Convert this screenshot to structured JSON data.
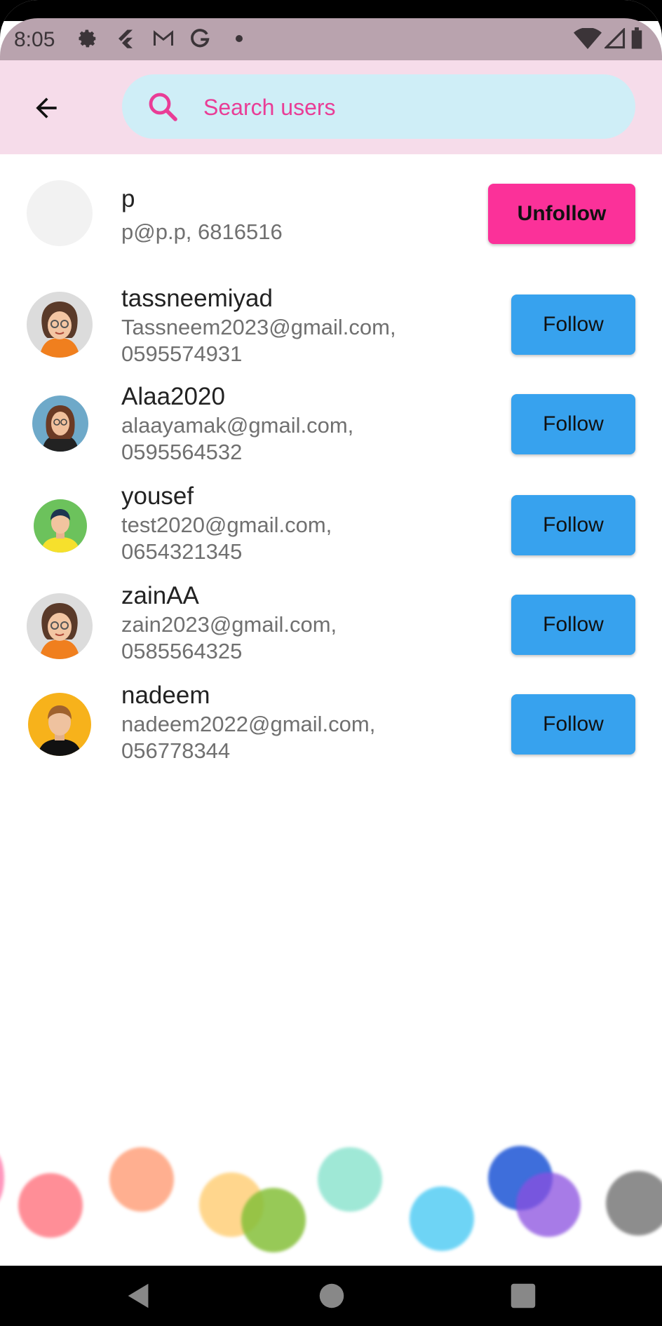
{
  "status_bar": {
    "time": "8:05",
    "left_icons": [
      "gear-icon",
      "flutter-icon",
      "gmail-icon",
      "google-icon",
      "dot-icon"
    ],
    "right_icons": [
      "wifi-icon",
      "signal-icon",
      "battery-icon"
    ]
  },
  "app_bar": {
    "back_icon": "arrow-left-icon",
    "search": {
      "placeholder": "Search users",
      "value": "",
      "icon": "search-icon"
    }
  },
  "users": [
    {
      "name": "p",
      "details": "p@p.p, 6816516",
      "action": "Unfollow",
      "avatar": "blank"
    },
    {
      "name": "tassneemiyad",
      "details": "Tassneem2023@gmail.com, 0595574931",
      "action": "Follow",
      "avatar": "woman-glasses"
    },
    {
      "name": "Alaa2020",
      "details": "alaayamak@gmail.com, 0595564532",
      "action": "Follow",
      "avatar": "woman-long-hair"
    },
    {
      "name": "yousef",
      "details": "test2020@gmail.com, 0654321345",
      "action": "Follow",
      "avatar": "boy-green"
    },
    {
      "name": "zainAA",
      "details": "zain2023@gmail.com, 0585564325",
      "action": "Follow",
      "avatar": "woman-glasses"
    },
    {
      "name": "nadeem",
      "details": "nadeem2022@gmail.com, 056778344",
      "action": "Follow",
      "avatar": "man-orange"
    }
  ],
  "colors": {
    "app_bar": "#f6dcea",
    "search_fill": "#cfeef7",
    "accent_pink": "#fb3199",
    "follow_blue": "#37a2ee"
  },
  "nav_bar": {
    "icons": [
      "back-triangle-icon",
      "home-circle-icon",
      "recents-square-icon"
    ]
  }
}
